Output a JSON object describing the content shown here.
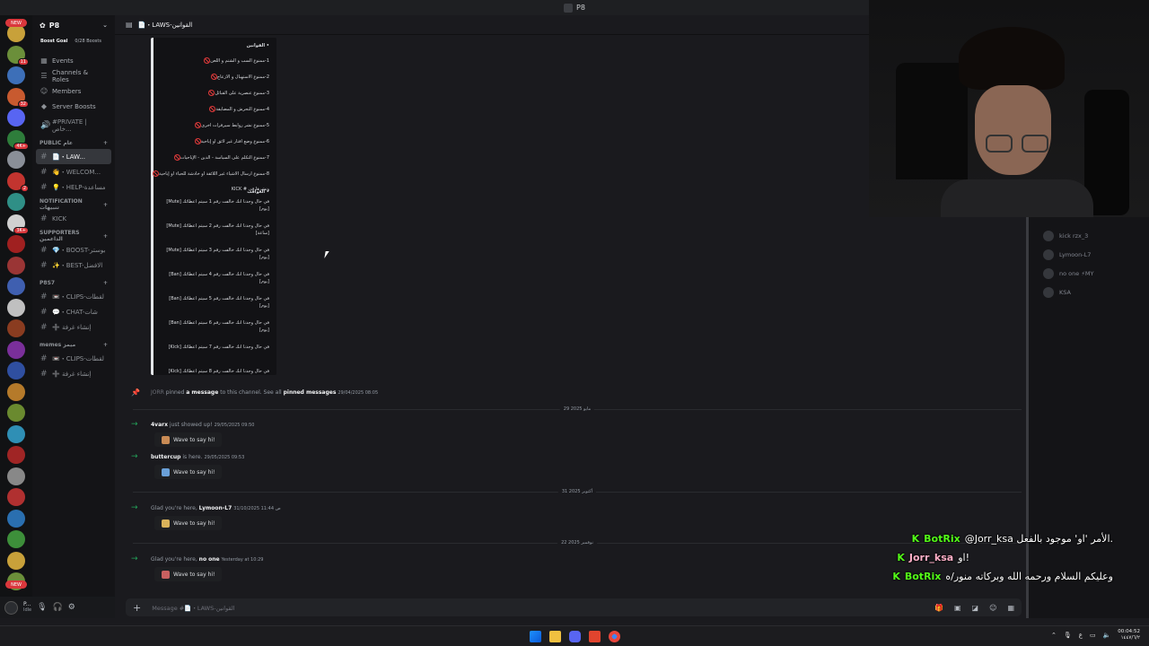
{
  "window": {
    "title": "P8"
  },
  "server": {
    "name": "P8",
    "boost_goal": "Boost Goal",
    "boosts": "0/28 Boosts"
  },
  "rail": {
    "new_top": "NEW",
    "new_bottom": "NEW",
    "badges": [
      "11",
      "32",
      "4K+",
      "2",
      "3K+",
      "31",
      "1",
      "4",
      "30",
      "3"
    ]
  },
  "nav": [
    {
      "label": "Events",
      "icon": "calendar-icon",
      "glyph": "▦"
    },
    {
      "label": "Channels & Roles",
      "icon": "list-icon",
      "glyph": "☰"
    },
    {
      "label": "Members",
      "icon": "members-icon",
      "glyph": "☺"
    },
    {
      "label": "Server Boosts",
      "icon": "boost-icon",
      "glyph": "◆"
    }
  ],
  "sidebar": {
    "private": "#PRIVATE | خاص...",
    "categories": [
      {
        "name": "PUBLIC عام",
        "channels": [
          {
            "label": "📄・LAW...",
            "active": true
          },
          {
            "label": "👋・WELCOM...",
            "active": false
          },
          {
            "label": "💡・HELP-مساعدة",
            "active": false
          }
        ]
      },
      {
        "name": "NOTIFICATION تنبيهات",
        "channels": [
          {
            "label": "KICK",
            "active": false
          }
        ]
      },
      {
        "name": "SUPPORTERS الداعمين",
        "channels": [
          {
            "label": "💎・BOOST-بوستر",
            "active": false
          },
          {
            "label": "✨・BEST-الافضل",
            "active": false
          }
        ]
      },
      {
        "name": "P8S7",
        "channels": [
          {
            "label": "📼・CLIPS-لقطات",
            "active": false
          },
          {
            "label": "💬・CHAT-شات",
            "active": false
          },
          {
            "label": "➕ إنشاء غرفة",
            "active": false
          }
        ]
      },
      {
        "name": "memes ميمز",
        "channels": [
          {
            "label": "📼・CLIPS-لقطات",
            "active": false
          },
          {
            "label": "➕ إنشاء غرفة",
            "active": false
          }
        ]
      }
    ]
  },
  "user": {
    "name": "P...",
    "status": "Idle"
  },
  "channel": {
    "name": "📄・LAWS-القوانين"
  },
  "rules": {
    "title": "• القوانين",
    "lines": [
      "1-ممنوع السب و الشتم و اللعن",
      "2-ممنوع الاستهبال و الازعاج",
      "3-ممنوع عنصرية على القبائل",
      "4-ممنوع التحرش و المضايقة",
      "5-ممنوع نشر روابط سيرفرات اخرى",
      "6-ممنوع وضع افتار غير لائق او إباحية",
      "7-ممنوع التكلم على السياسة - الدين - الإباحيات",
      "8-ممنوع ارسال الاشياء غير اللائقة او خادشة للحياء او إباحية",
      "ونشرها في # KICK"
    ],
    "penalties_title": "• العواقب",
    "penalties": [
      "في حال وجدنا انك خالفت رقم 1 سيتم اعطائك [Mute]",
      "في حال وجدنا انك خالفت رقم 2 سيتم اعطائك [Mute]",
      "في حال وجدنا انك خالفت رقم 3 سيتم اعطائك [Mute]",
      "في حال وجدنا انك خالفت رقم 4 سيتم اعطائك [Ban]",
      "في حال وجدنا انك خالفت رقم 5 سيتم اعطائك [Ban]",
      "في حال وجدنا انك خالفت رقم 6 سيتم اعطائك [Ban]",
      "في حال وجدنا انك خالفت رقم 7 سيتم اعطائك [Kick]",
      "في حال وجدنا انك خالفت رقم 8 سيتم اعطائك [Kick]"
    ],
    "durations": [
      "[يوم]",
      "[ساعة]",
      "[يوم]",
      "[يوم]",
      "[يوم]",
      "[يوم]"
    ]
  },
  "messages": {
    "pin": {
      "user": "JORR",
      "text1": "pinned",
      "text2": "a message",
      "text3": "to this channel. See all",
      "text4": "pinned messages",
      "time": "29/04/2025 08:05"
    },
    "date1": "29 مايو 2025",
    "join1": {
      "user": "4varx",
      "text": "just showed up!",
      "time": "29/05/2025 09:50"
    },
    "join2": {
      "user": "buttercup",
      "text": "is here.",
      "time": "29/05/2025 09:53"
    },
    "date2": "31 أكتوبر 2025",
    "join3": {
      "pre": "Glad you're here,",
      "user": "Lymoon-L7",
      "time": "31/10/2025 11:44 ص"
    },
    "date3": "22 نوفمبر 2025",
    "join4": {
      "pre": "Glad you're here,",
      "user": "no one",
      "time": "Yesterday at 10:29"
    },
    "wave": "Wave to say hi!"
  },
  "composer": {
    "placeholder": "Message #📄・LAWS-القوانين"
  },
  "members": [
    {
      "name": "kick rzx_3"
    },
    {
      "name": "Lymoon-L7"
    },
    {
      "name": "no one ⚡MY"
    },
    {
      "name": "KSA"
    }
  ],
  "chat_overlay": [
    {
      "user": "BotRix",
      "text": "@Jorr_ksa الأمر 'او' موجود بالفعل.",
      "pink": false
    },
    {
      "user": "Jorr_ksa",
      "text": "او!",
      "pink": true
    },
    {
      "user": "BotRix",
      "text": "وعليكم السلام ورحمه الله وبركاته منور/ه",
      "pink": false
    }
  ],
  "tray": {
    "lang": "ع",
    "time": "00:04:52",
    "date": "١٤٤٧/٦/٢"
  },
  "colors": {
    "accent": "#5865f2",
    "kick_green": "#53fc18",
    "danger": "#da373c"
  }
}
